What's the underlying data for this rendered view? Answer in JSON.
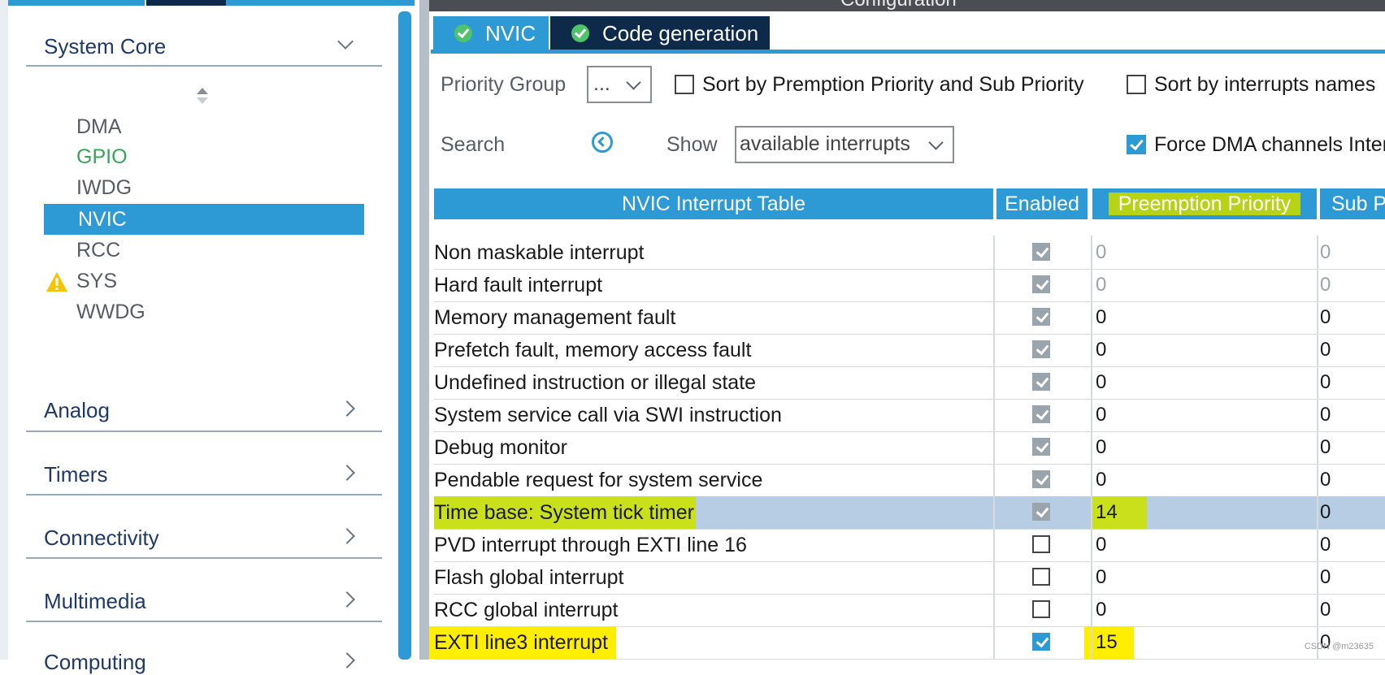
{
  "left_panel": {
    "categories": [
      {
        "label": "System Core",
        "expanded": true
      },
      {
        "label": "Analog"
      },
      {
        "label": "Timers"
      },
      {
        "label": "Connectivity"
      },
      {
        "label": "Multimedia"
      },
      {
        "label": "Computing"
      }
    ],
    "system_core_items": [
      "DMA",
      "GPIO",
      "IWDG",
      "NVIC",
      "RCC",
      "SYS",
      "WWDG"
    ],
    "selected_item": "NVIC",
    "colors": {
      "accent": "#2d9ad6",
      "gpio_text": "#3aa35a",
      "warning": "#f5c400"
    }
  },
  "header": {
    "configuration_title": "Configuration"
  },
  "tabs": [
    {
      "label": "NVIC",
      "active": true
    },
    {
      "label": "Code generation",
      "active": false
    }
  ],
  "controls": {
    "priority_group_label": "Priority Group",
    "priority_group_value": "...",
    "sort_premption_label": "Sort by Premption Priority and Sub Priority",
    "sort_names_label": "Sort by interrupts names",
    "search_label": "Search",
    "show_label": "Show",
    "show_value": "available interrupts",
    "force_dma_label": "Force DMA channels Interrupts",
    "force_dma_checked": true
  },
  "table": {
    "headers": {
      "name": "NVIC Interrupt Table",
      "enabled": "Enabled",
      "preemption": "Preemption Priority",
      "sub": "Sub Priority"
    },
    "rows": [
      {
        "name": "Non maskable interrupt",
        "enabled": "locked",
        "preemption": "0",
        "sub": "0"
      },
      {
        "name": "Hard fault interrupt",
        "enabled": "locked",
        "preemption": "0",
        "sub": "0"
      },
      {
        "name": "Memory management fault",
        "enabled": "locked",
        "preemption": "0",
        "sub": "0"
      },
      {
        "name": "Prefetch fault, memory access fault",
        "enabled": "locked",
        "preemption": "0",
        "sub": "0"
      },
      {
        "name": "Undefined instruction or illegal state",
        "enabled": "locked",
        "preemption": "0",
        "sub": "0"
      },
      {
        "name": "System service call via SWI instruction",
        "enabled": "locked",
        "preemption": "0",
        "sub": "0"
      },
      {
        "name": "Debug monitor",
        "enabled": "locked",
        "preemption": "0",
        "sub": "0"
      },
      {
        "name": "Pendable request for system service",
        "enabled": "locked",
        "preemption": "0",
        "sub": "0"
      },
      {
        "name": "Time base: System tick timer",
        "enabled": "locked",
        "preemption": "14",
        "sub": "0"
      },
      {
        "name": "PVD interrupt through EXTI line 16",
        "enabled": "off",
        "preemption": "0",
        "sub": "0"
      },
      {
        "name": "Flash global interrupt",
        "enabled": "off",
        "preemption": "0",
        "sub": "0"
      },
      {
        "name": "RCC global interrupt",
        "enabled": "off",
        "preemption": "0",
        "sub": "0"
      },
      {
        "name": "EXTI line3 interrupt",
        "enabled": "on",
        "preemption": "15",
        "sub": "0"
      }
    ]
  },
  "watermark": "CSDN @m23635"
}
